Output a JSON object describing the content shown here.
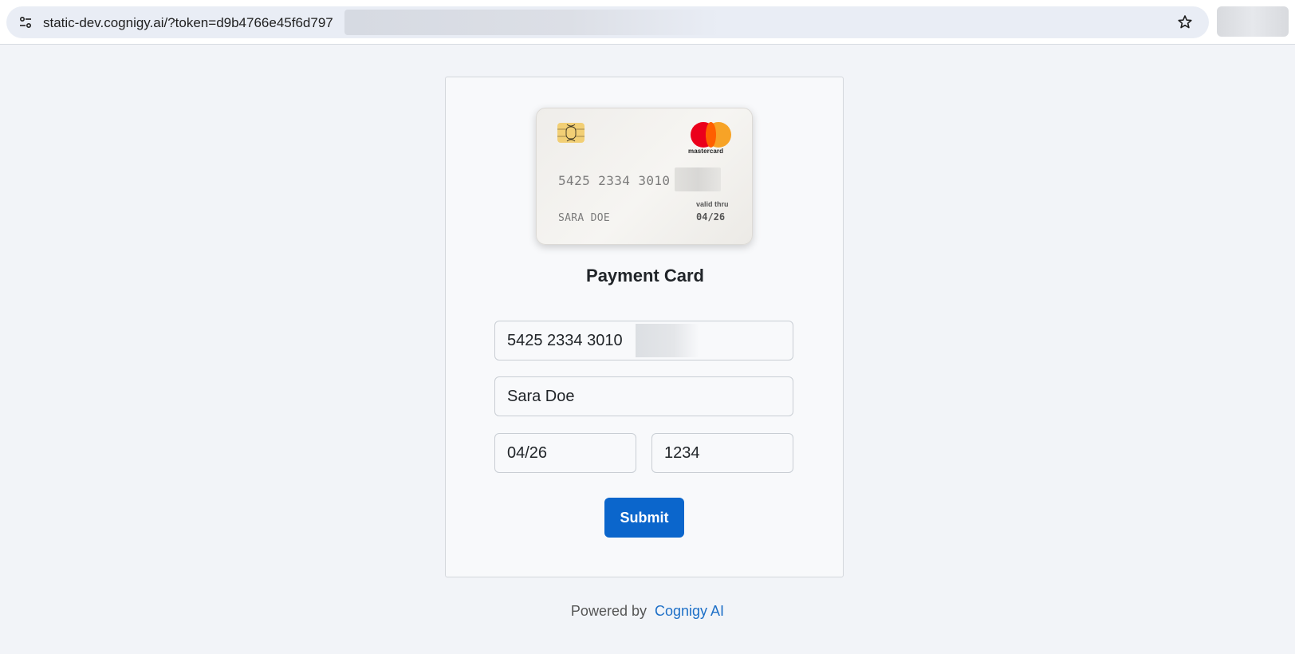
{
  "browser": {
    "url": "static-dev.cognigy.ai/?token=d9b4766e45f6d797",
    "site_info_icon": "tune-icon",
    "bookmark_icon": "star-icon"
  },
  "card_preview": {
    "number": "5425 2334 3010",
    "holder": "SARA DOE",
    "valid_label": "valid thru",
    "expiry": "04/26",
    "brand": "mastercard",
    "brand_colors": {
      "red": "#eb001b",
      "yellow": "#f79e1b"
    }
  },
  "form": {
    "title": "Payment Card",
    "card_number": "5425 2334 3010",
    "card_name": "Sara Doe",
    "expiry": "04/26",
    "cvv": "1234",
    "submit_label": "Submit"
  },
  "footer": {
    "prefix": "Powered by",
    "link": "Cognigy AI"
  },
  "colors": {
    "accent": "#0b66cc",
    "link": "#1d6fc7"
  }
}
